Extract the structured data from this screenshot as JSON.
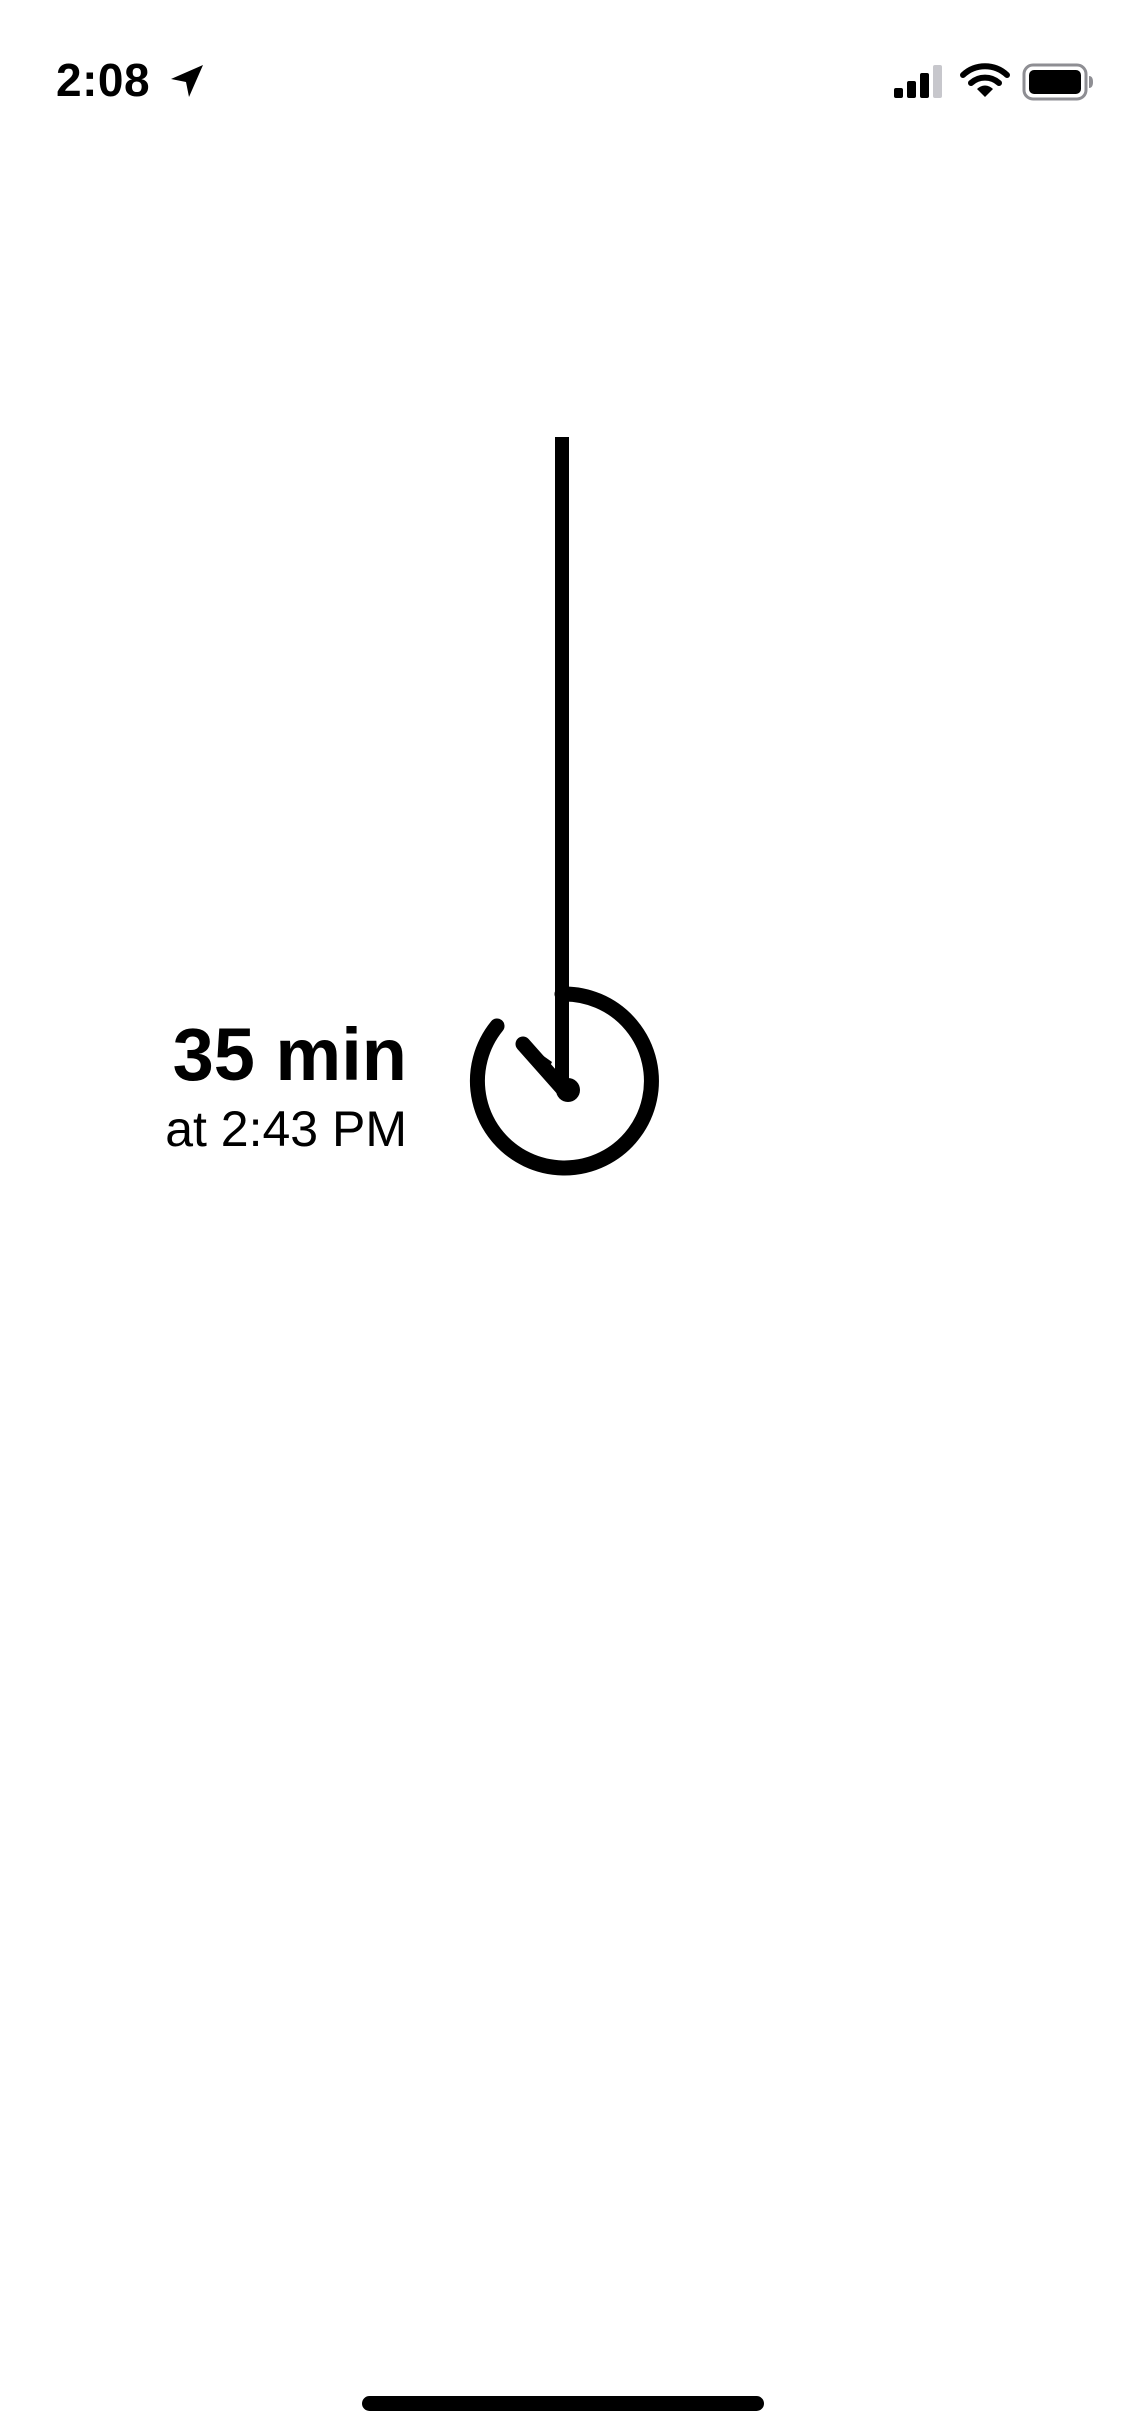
{
  "status_bar": {
    "time": "2:08",
    "icons": {
      "location": "location-arrow-icon",
      "signal": "cellular-signal-icon",
      "wifi": "wifi-icon",
      "battery": "battery-icon"
    }
  },
  "timer": {
    "duration": "35 min",
    "arrival": "at 2:43 PM",
    "icon": "stopwatch-dial-icon"
  },
  "colors": {
    "foreground": "#000000",
    "background": "#ffffff",
    "inactive_signal": "#c7c7cc"
  }
}
